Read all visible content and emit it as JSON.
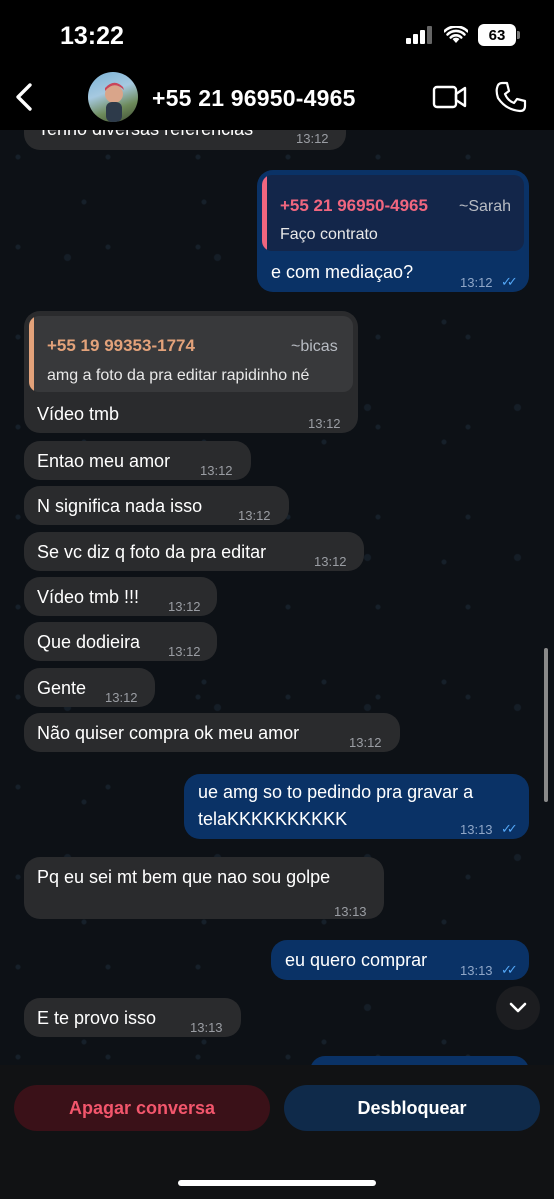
{
  "status_bar": {
    "time": "13:22",
    "battery": "63"
  },
  "header": {
    "contact_name": "+55 21 96950-4965"
  },
  "icons": {
    "back": "chevron-left-icon",
    "video": "video-camera-icon",
    "call": "phone-icon",
    "scroll_down": "chevron-down-icon",
    "read": "double-check-icon"
  },
  "colors": {
    "incoming_bubble": "#2a2b2d",
    "outgoing_bubble": "#0a3266",
    "quote_sarah": "#f0667f",
    "quote_bicas": "#e3a27a",
    "read_ticks": "#53a6f5",
    "delete_text": "#f2566c"
  },
  "messages": [
    {
      "direction": "in",
      "text": "Tenho diversas referencias",
      "time": "13:12"
    },
    {
      "direction": "out",
      "quote": {
        "name": "+55 21 96950-4965",
        "alias": "~Sarah",
        "text": "Faço contrato"
      },
      "text": "e com mediaçao?",
      "time": "13:12",
      "ticks": "✓✓"
    },
    {
      "direction": "in",
      "quote": {
        "name": "+55 19 99353-1774",
        "alias": "~bicas",
        "text": "amg a foto da pra editar rapidinho né"
      },
      "text": "Vídeo tmb",
      "time": "13:12"
    },
    {
      "direction": "in",
      "text": "Entao meu amor",
      "time": "13:12"
    },
    {
      "direction": "in",
      "text": "N significa nada isso",
      "time": "13:12"
    },
    {
      "direction": "in",
      "text": "Se vc diz q foto da pra editar",
      "time": "13:12"
    },
    {
      "direction": "in",
      "text": "Vídeo tmb !!!",
      "time": "13:12"
    },
    {
      "direction": "in",
      "text": "Que dodieira",
      "time": "13:12"
    },
    {
      "direction": "in",
      "text": "Gente",
      "time": "13:12"
    },
    {
      "direction": "in",
      "text": "Não quiser compra ok meu amor",
      "time": "13:12"
    },
    {
      "direction": "out",
      "lines": [
        "ue amg so to pedindo pra gravar a",
        "telaKKKKKKKKKK"
      ],
      "time": "13:13",
      "ticks": "✓✓"
    },
    {
      "direction": "in",
      "text": "Pq eu sei mt bem que nao sou golpe",
      "time": "13:13"
    },
    {
      "direction": "out",
      "text": "eu quero comprar",
      "time": "13:13",
      "ticks": "✓✓"
    },
    {
      "direction": "in",
      "text": "E te provo  isso",
      "time": "13:13"
    }
  ],
  "footer": {
    "delete_label": "Apagar conversa",
    "unblock_label": "Desbloquear"
  }
}
